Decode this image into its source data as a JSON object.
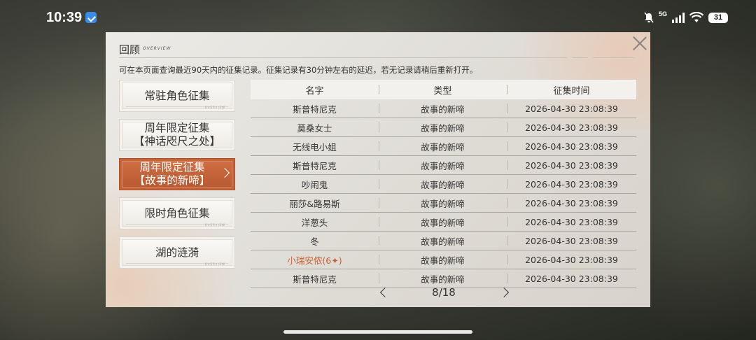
{
  "status_bar": {
    "time": "10:39",
    "network": "5G",
    "battery": "31"
  },
  "panel": {
    "title": "回顾",
    "title_en": "OVERVIEW",
    "notice": "可在本页面查询最近90天内的征集记录。征集记录有30分钟左右的延迟，若无记录请稍后重新打开。"
  },
  "sidebar": {
    "items": [
      {
        "label": "常驻角色征集",
        "active": false
      },
      {
        "label": "周年限定征集\n【神话咫尺之处】",
        "active": false
      },
      {
        "label": "周年限定征集\n【故事的新啼】",
        "active": true
      },
      {
        "label": "限时角色征集",
        "active": false
      },
      {
        "label": "湖的涟漪",
        "active": false
      }
    ],
    "deco_tag": "OVERVIEW"
  },
  "table": {
    "headers": [
      "名字",
      "类型",
      "征集时间"
    ],
    "rows": [
      {
        "name": "斯普特尼克",
        "type": "故事的新啼",
        "time": "2026-04-30 23:08:39",
        "highlight": false
      },
      {
        "name": "莫桑女士",
        "type": "故事的新啼",
        "time": "2026-04-30 23:08:39",
        "highlight": false
      },
      {
        "name": "无线电小姐",
        "type": "故事的新啼",
        "time": "2026-04-30 23:08:39",
        "highlight": false
      },
      {
        "name": "斯普特尼克",
        "type": "故事的新啼",
        "time": "2026-04-30 23:08:39",
        "highlight": false
      },
      {
        "name": "吵闹鬼",
        "type": "故事的新啼",
        "time": "2026-04-30 23:08:39",
        "highlight": false
      },
      {
        "name": "丽莎&路易斯",
        "type": "故事的新啼",
        "time": "2026-04-30 23:08:39",
        "highlight": false
      },
      {
        "name": "洋葱头",
        "type": "故事的新啼",
        "time": "2026-04-30 23:08:39",
        "highlight": false
      },
      {
        "name": "冬",
        "type": "故事的新啼",
        "time": "2026-04-30 23:08:39",
        "highlight": false
      },
      {
        "name": "小瑞安侬(6✦)",
        "type": "故事的新啼",
        "time": "2026-04-30 23:08:39",
        "highlight": true
      },
      {
        "name": "斯普特尼克",
        "type": "故事的新啼",
        "time": "2026-04-30 23:08:39",
        "highlight": false
      }
    ]
  },
  "pager": {
    "text": "8/18"
  },
  "colors": {
    "accent": "#c4633a",
    "panel": "#e6e3de"
  },
  "icons": [
    "close-icon",
    "chevron-right-icon",
    "chevron-left-icon",
    "wifi-icon",
    "signal-icon",
    "battery-icon",
    "mute-bell-icon"
  ]
}
